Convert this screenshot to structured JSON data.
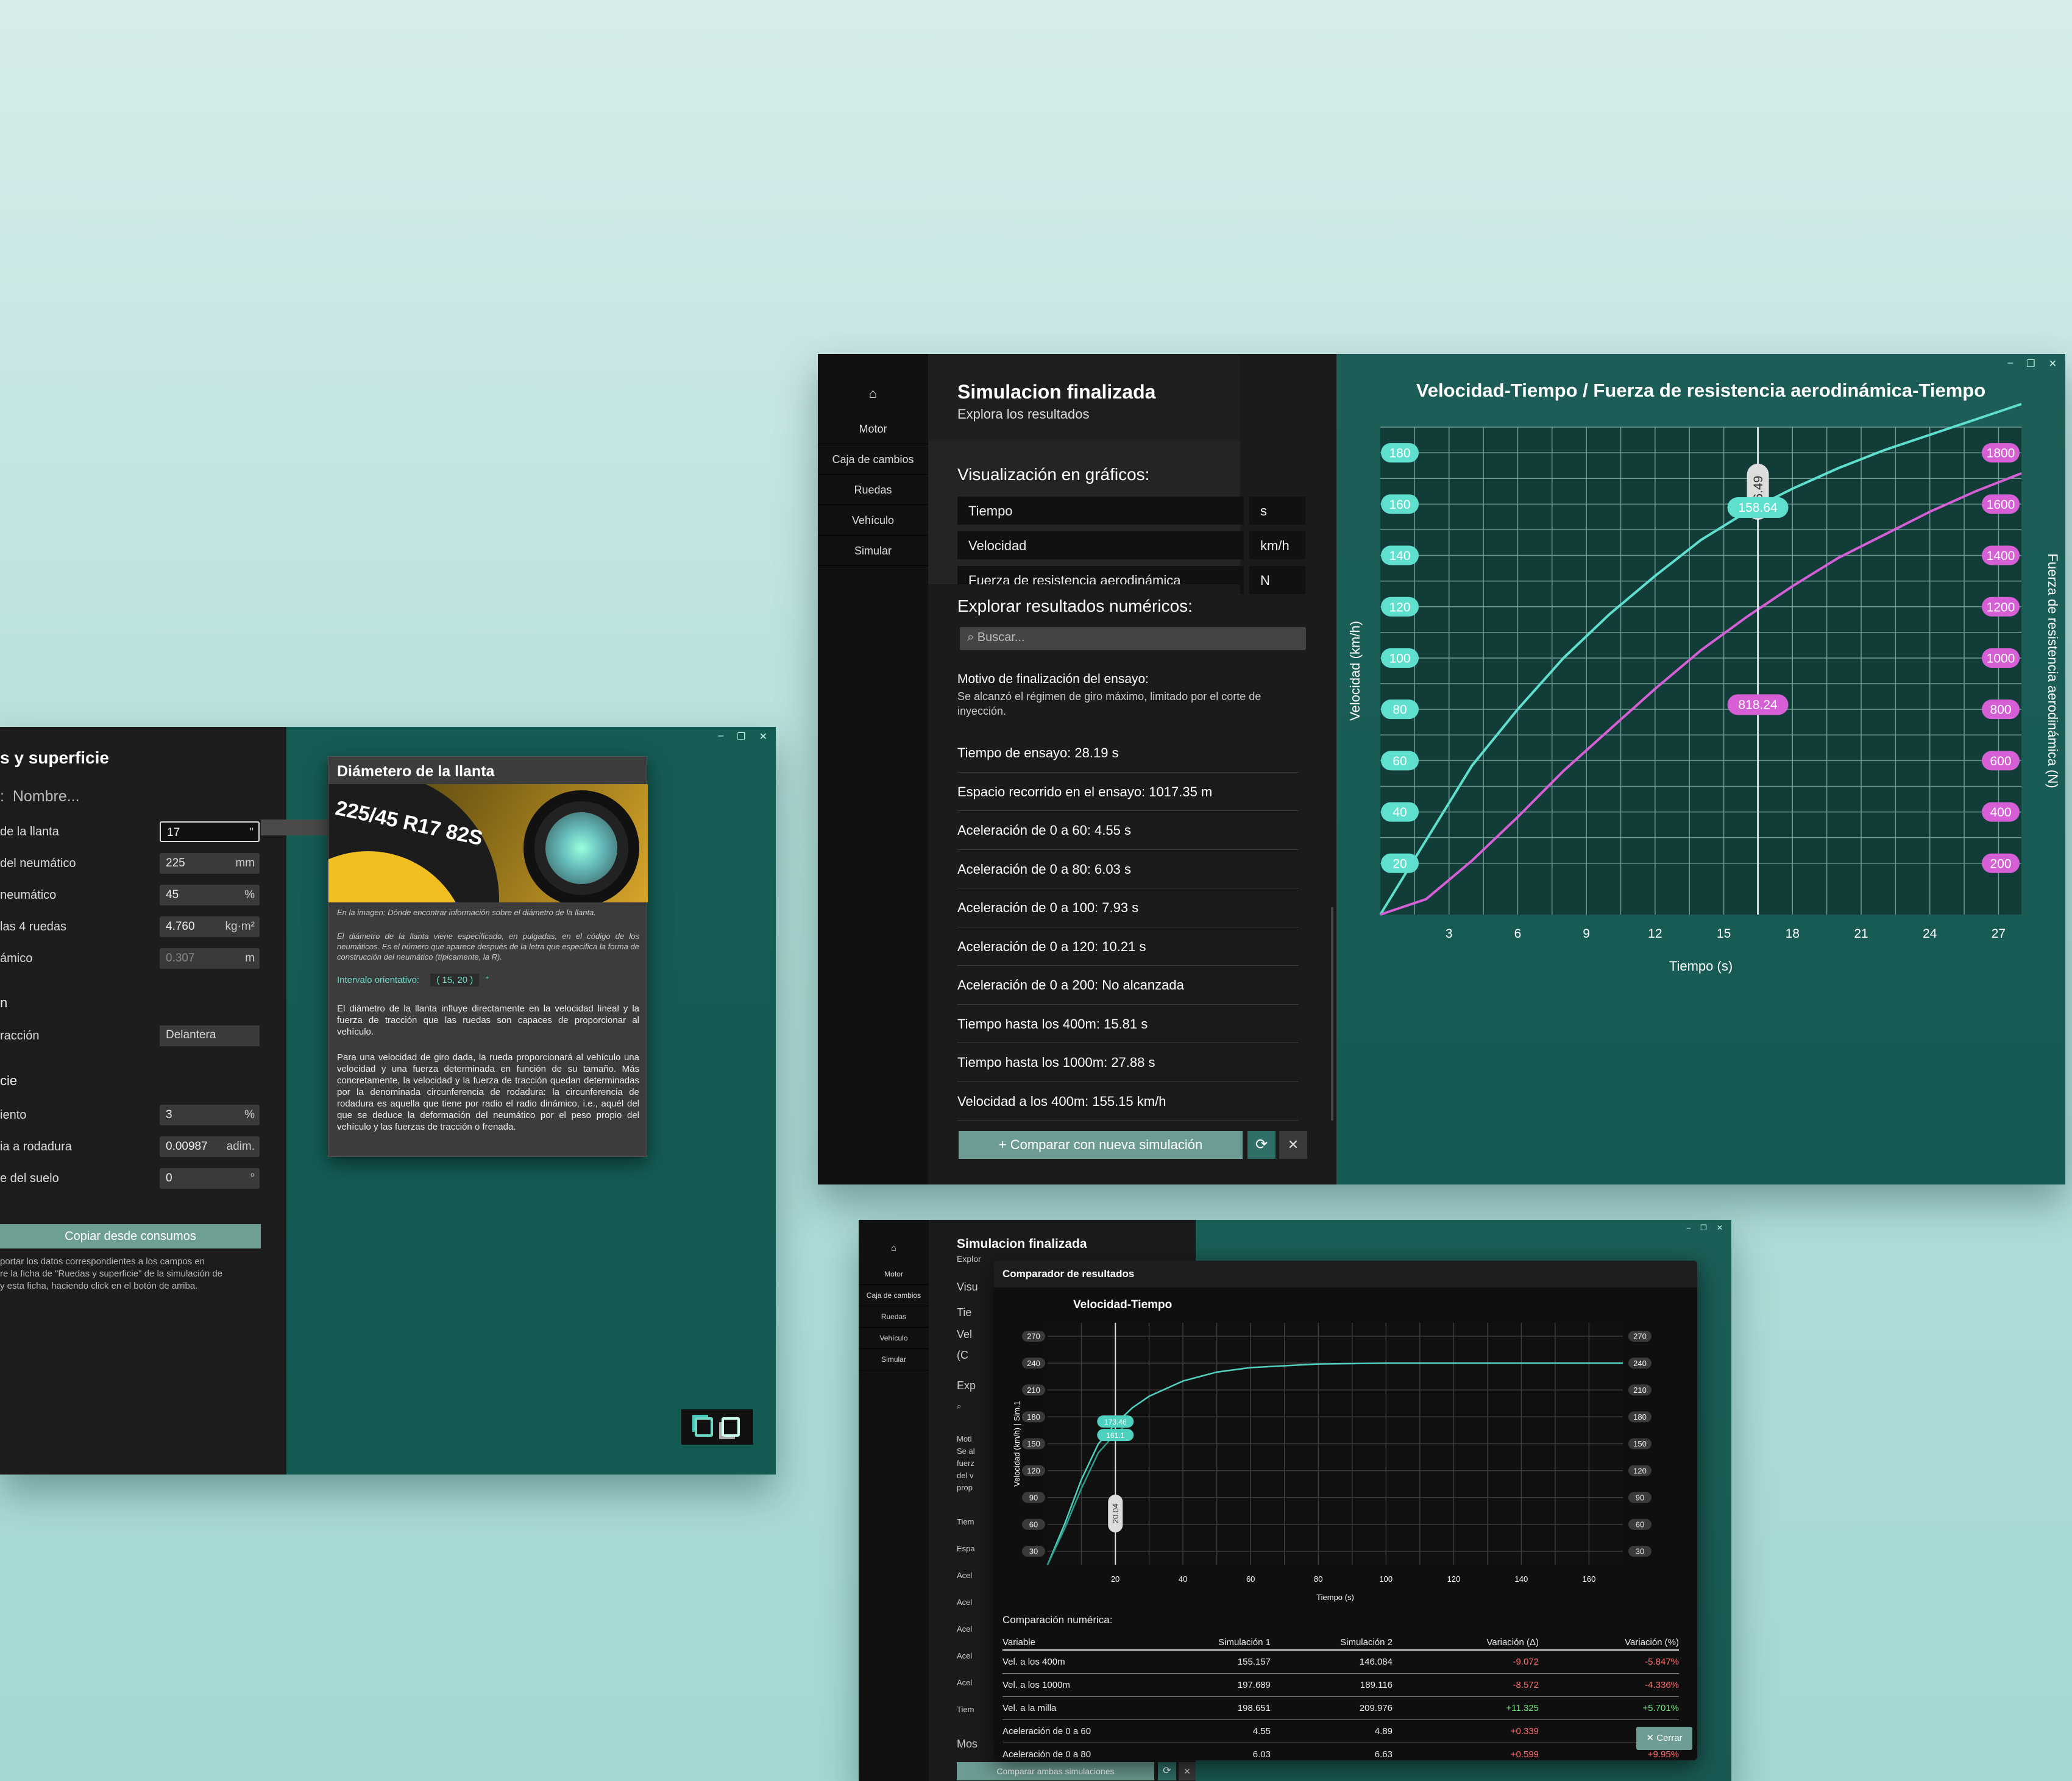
{
  "nav": {
    "home_icon": "home-icon",
    "items": [
      "Motor",
      "Caja de cambios",
      "Ruedas",
      "Vehículo",
      "Simular"
    ]
  },
  "wheels_window": {
    "title": "s y superficie",
    "name_placeholder": "Nombre...",
    "fields": [
      {
        "label": "de la llanta",
        "value": "17",
        "unit": "\""
      },
      {
        "label": "del neumático",
        "value": "225",
        "unit": "mm"
      },
      {
        "label": "neumático",
        "value": "45",
        "unit": "%"
      },
      {
        "label": "las 4 ruedas",
        "value": "4.760",
        "unit": "kg·m²"
      },
      {
        "label": "ámico",
        "value": "0.307",
        "unit": "m"
      }
    ],
    "section2": "n",
    "traction_label": "racción",
    "traction_value": "Delantera",
    "section3": "cie",
    "fields2": [
      {
        "label": "iento",
        "value": "3",
        "unit": "%"
      },
      {
        "label": "ia a rodadura",
        "value": "0.00987",
        "unit": "adim."
      },
      {
        "label": "e del suelo",
        "value": "0",
        "unit": "°"
      }
    ],
    "copy_button": "Copiar desde consumos",
    "copy_help": "portar los datos correspondientes a los campos en\nre la ficha de \"Ruedas y superficie\" de la simulación de\ny esta ficha, haciendo click en el botón de arriba.",
    "tooltip": {
      "title": "Diámetero de la llanta",
      "tire_text": "225/45 R17 82S",
      "caption": "En la imagen: Dónde encontrar información sobre el diámetro de la llanta.",
      "italic": "El diámetro de la llanta viene especificado, en pulgadas, en el código de los neumáticos. Es el número que aparece después de la letra que especifica la forma de construcción del neumático (típicamente, la R).",
      "interval_label": "Intervalo orientativo:",
      "interval_value": "( 15, 20 )",
      "interval_unit": "\"",
      "p1": "El diámetro de la llanta influye directamente en la velocidad lineal y la fuerza de tracción que las ruedas son capaces de proporcionar al vehículo.",
      "p2": "Para una velocidad de giro dada, la rueda proporcionará al vehículo una velocidad y una fuerza determinada en función de su tamaño. Más concretamente, la velocidad y la fuerza de tracción quedan determinadas por la denominada circunferencia de rodadura: la circunferencia de rodadura es aquella que tiene por radio el radio dinámico, i.e., aquél del que se deduce la deformación del neumático por el peso propio del vehículo y las fuerzas de tracción o frenada."
    }
  },
  "main_window": {
    "title": "Simulacion finalizada",
    "subtitle": "Explora los resultados",
    "graphs_heading": "Visualización en gráficos:",
    "graph_rows": [
      {
        "label": "Tiempo",
        "unit": "s"
      },
      {
        "label": "Velocidad",
        "unit": "km/h"
      },
      {
        "label": "Fuerza de resistencia aerodinámica",
        "unit": "N"
      }
    ],
    "numeric_heading": "Explorar resultados numéricos:",
    "search_placeholder": "⌕ Buscar...",
    "reason_title": "Motivo de finalización del ensayo:",
    "reason_text": "Se alcanzó el régimen de giro máximo, limitado por el corte de inyección.",
    "results": [
      "Tiempo de ensayo: 28.19 s",
      "Espacio recorrido en el ensayo: 1017.35 m",
      "Aceleración de 0 a 60: 4.55 s",
      "Aceleración de 0 a 80: 6.03 s",
      "Aceleración de 0 a 100: 7.93 s",
      "Aceleración de 0 a 120: 10.21 s",
      "Aceleración de 0 a 200: No alcanzada",
      "Tiempo hasta los 400m: 15.81 s",
      "Tiempo hasta los 1000m: 27.88 s",
      "Velocidad a los 400m: 155.15 km/h"
    ],
    "compare_button": "+ Comparar con nueva simulación",
    "chart_title": "Velocidad-Tiempo / Fuerza de resistencia aerodinámica-Tiempo"
  },
  "compare_window": {
    "bg_title": "Simulacion finalizada",
    "bg_sub": "Explor",
    "bg_side": [
      "Visu",
      "Tie",
      "Vel",
      "(C",
      "Exp",
      "⌕",
      "Moti",
      "Se al",
      "fuerz",
      "del v",
      "prop",
      "Tiem",
      "Espa",
      "Acel",
      "Acel",
      "Acel",
      "Acel",
      "Acel",
      "Tiem",
      "Mos"
    ],
    "compare_all_button": "Comparar ambas simulaciones",
    "modal_title": "Comparador de resultados",
    "chart_title": "Velocidad-Tiempo",
    "numeric_heading": "Comparación numérica:",
    "table_headers": [
      "Variable",
      "Simulación 1",
      "Simulación 2",
      "Variación (Δ)",
      "Variación (%)"
    ],
    "table_rows": [
      [
        "Vel. a los 400m",
        "155.157",
        "146.084",
        "-9.072",
        "-5.847%"
      ],
      [
        "Vel. a los 1000m",
        "197.689",
        "189.116",
        "-8.572",
        "-4.336%"
      ],
      [
        "Vel. a la milla",
        "198.651",
        "209.976",
        "+11.325",
        "+5.701%"
      ],
      [
        "Aceleración de 0 a 60",
        "4.55",
        "4.89",
        "+0.339",
        "+7.451%"
      ],
      [
        "Aceleración de 0 a 80",
        "6.03",
        "6.63",
        "+0.599",
        "+9.95%"
      ]
    ],
    "close_button": "✕ Cerrar"
  },
  "chart_data": [
    {
      "type": "line",
      "title": "Velocidad-Tiempo / Fuerza de resistencia aerodinámica-Tiempo",
      "xlabel": "Tiempo (s)",
      "ylabel": "Velocidad (km/h)",
      "y2label": "Fuerza de resistencia aerodinámica (N)",
      "xlim": [
        0,
        28
      ],
      "ylim": [
        0,
        190
      ],
      "y2lim": [
        0,
        1900
      ],
      "xticks": [
        3,
        6,
        9,
        12,
        15,
        18,
        21,
        24,
        27
      ],
      "yticks": [
        20,
        40,
        60,
        80,
        100,
        120,
        140,
        160,
        180
      ],
      "y2ticks": [
        200,
        400,
        600,
        800,
        1000,
        1200,
        1400,
        1600,
        1800
      ],
      "grid": true,
      "cursor": {
        "x": 16.49,
        "label": "16.49",
        "speed_label": "158.64",
        "force_label": "818.24"
      },
      "series": [
        {
          "axis": "left",
          "color": "#5fe0cf",
          "x": [
            0,
            2,
            4,
            6,
            8,
            10,
            12,
            14,
            16,
            18,
            20,
            22,
            24,
            26,
            28
          ],
          "y": [
            0,
            29,
            58,
            80,
            100,
            117,
            132,
            146,
            157,
            166,
            174,
            181,
            187,
            193,
            199
          ]
        },
        {
          "axis": "right",
          "color": "#d65fd6",
          "x": [
            0,
            2,
            4,
            6,
            8,
            10,
            12,
            14,
            16,
            18,
            20,
            22,
            24,
            26,
            28
          ],
          "y": [
            0,
            60,
            210,
            380,
            560,
            720,
            880,
            1030,
            1160,
            1280,
            1390,
            1480,
            1570,
            1650,
            1720
          ]
        }
      ]
    },
    {
      "type": "line",
      "title": "Velocidad-Tiempo",
      "xlabel": "Tiempo (s)",
      "ylabel": "Velocidad (km/h) | Sim.1",
      "xlim": [
        0,
        170
      ],
      "ylim": [
        15,
        285
      ],
      "xticks": [
        20,
        40,
        60,
        80,
        100,
        120,
        140,
        160
      ],
      "yticks": [
        30,
        60,
        90,
        120,
        150,
        180,
        210,
        240,
        270
      ],
      "grid": true,
      "cursor": {
        "x": 20.04,
        "label": "20.04",
        "labels": [
          "173.46",
          "161.1"
        ]
      },
      "series": [
        {
          "name": "Sim. 1",
          "color": "#4fd1bf",
          "x": [
            0,
            5,
            10,
            15,
            20,
            25,
            30,
            40,
            50,
            60,
            80,
            100,
            120,
            140,
            160,
            170
          ],
          "y": [
            15,
            60,
            110,
            150,
            172,
            190,
            203,
            220,
            230,
            235,
            239,
            240,
            240,
            240,
            240,
            240
          ]
        },
        {
          "name": "Sim. 2",
          "color": "#2e9c8c",
          "x": [
            0,
            5,
            10,
            15,
            20,
            25
          ],
          "y": [
            15,
            55,
            100,
            140,
            161,
            176
          ]
        }
      ]
    }
  ]
}
